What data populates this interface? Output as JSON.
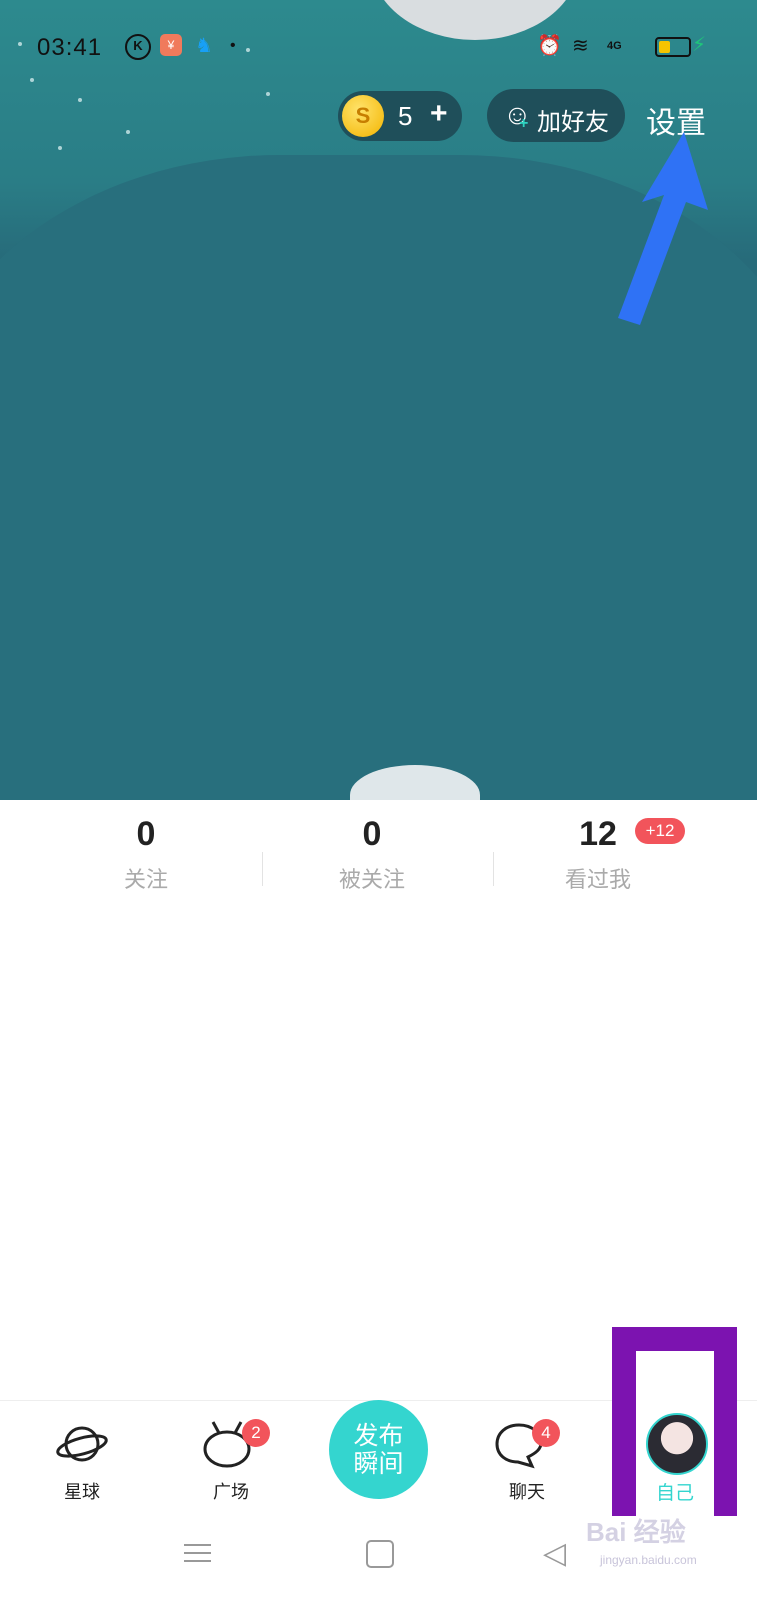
{
  "status_bar": {
    "time": "03:41",
    "k_icon": "K",
    "app_icon": "¥",
    "qq_icon": "♞",
    "dot": "•",
    "alarm_icon": "⏰",
    "wifi_icon": "≋",
    "network": "4G"
  },
  "top_actions": {
    "coin_symbol": "S",
    "coin_count": "5",
    "coin_plus": "+",
    "add_friend_label": "加好友",
    "settings_label": "设置"
  },
  "stats": [
    {
      "value": "0",
      "label": "关注"
    },
    {
      "value": "0",
      "label": "被关注"
    },
    {
      "value": "12",
      "label": "看过我",
      "badge": "+12"
    }
  ],
  "tabbar": {
    "planet_label": "星球",
    "square_label": "广场",
    "square_badge": "2",
    "publish_line1": "发布",
    "publish_line2": "瞬间",
    "chat_label": "聊天",
    "chat_badge": "4",
    "me_label": "自己"
  },
  "nav": {
    "back_icon": "◁"
  },
  "watermark": {
    "text": "Bai 经验",
    "sub": "jingyan.baidu.com"
  },
  "colors": {
    "hero": "#276b7a",
    "accent": "#34d5cf",
    "badge": "#f2545b",
    "annotation_arrow": "#2f72f5",
    "annotation_box": "#7c13b0"
  }
}
